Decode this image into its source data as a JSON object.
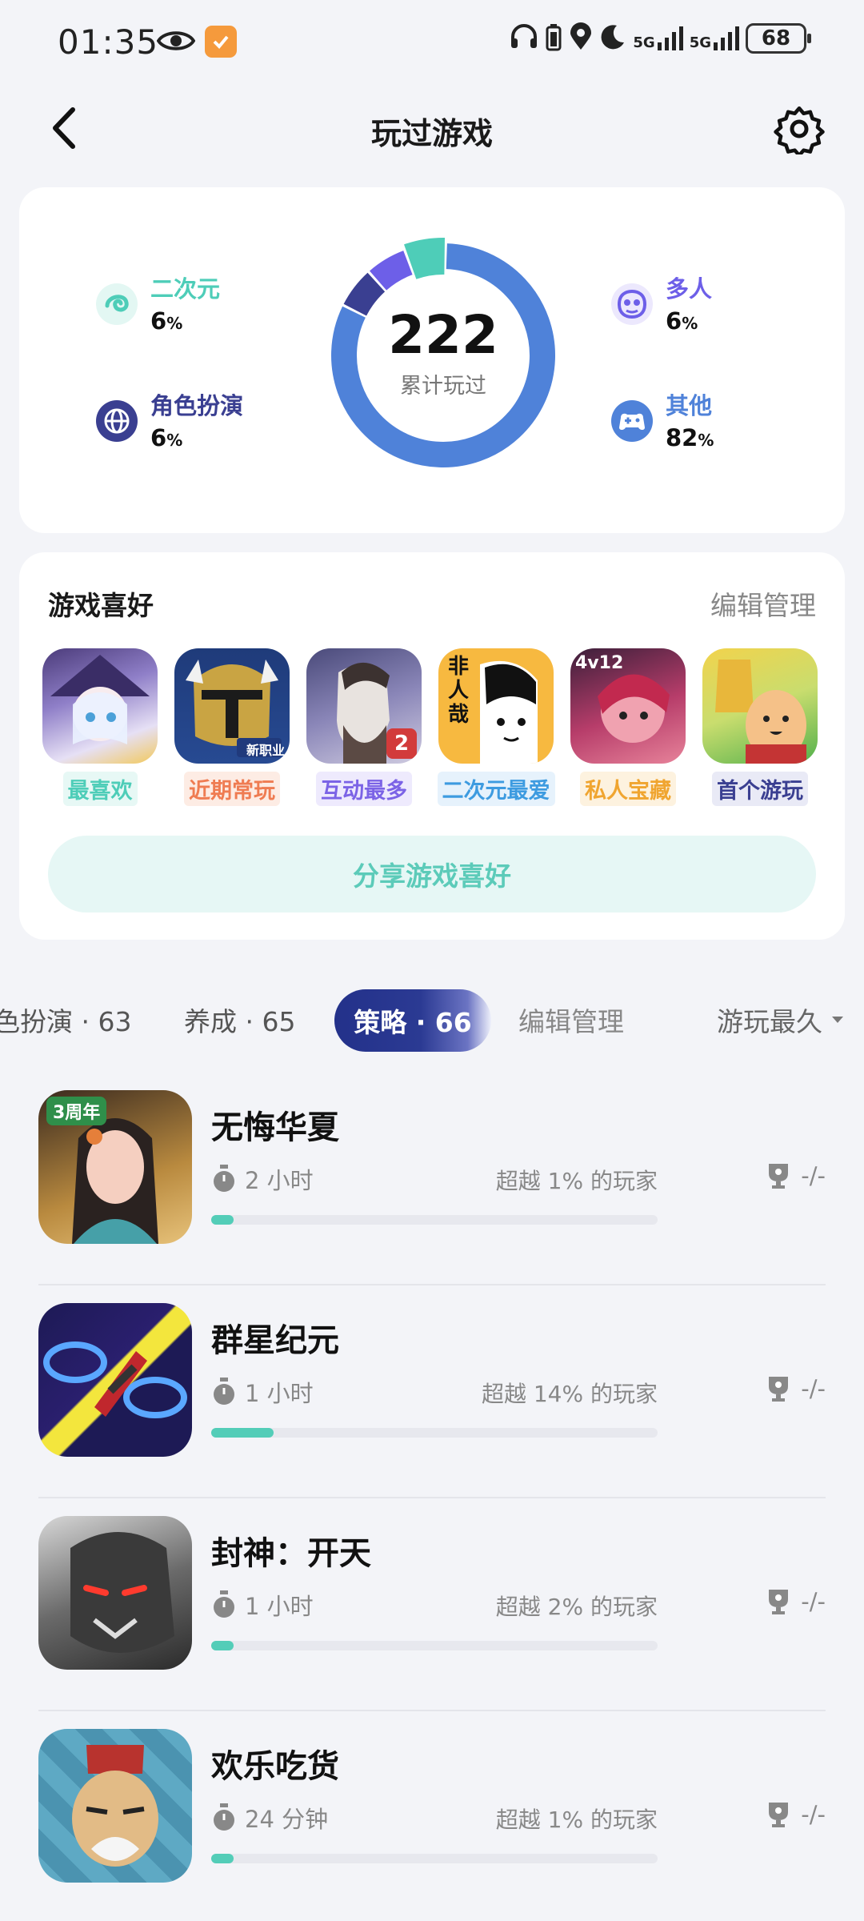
{
  "status_bar": {
    "time": "01:35",
    "signal1": "5G",
    "signal2": "5G",
    "battery": "68"
  },
  "header": {
    "title": "玩过游戏"
  },
  "stats": {
    "total": "222",
    "total_label": "累计玩过",
    "categories": [
      {
        "label": "二次元",
        "value": "6",
        "unit": "%",
        "color": "#4ecdb8",
        "icon": "anime-swirl-icon",
        "percent": 6
      },
      {
        "label": "角色扮演",
        "value": "6",
        "unit": "%",
        "color": "#3a3f91",
        "icon": "globe-icon",
        "percent": 6
      },
      {
        "label": "多人",
        "value": "6",
        "unit": "%",
        "color": "#6d5fe8",
        "icon": "multiplayer-icon",
        "percent": 6
      },
      {
        "label": "其他",
        "value": "82",
        "unit": "%",
        "color": "#4f82d9",
        "icon": "gamepad-icon",
        "percent": 82
      }
    ]
  },
  "preferences": {
    "title": "游戏喜好",
    "edit_label": "编辑管理",
    "share_label": "分享游戏喜好",
    "items": [
      {
        "tag": "最喜欢",
        "tag_color": "#4ecdb8",
        "tag_bg": "#e7f8f5",
        "badge": ""
      },
      {
        "tag": "近期常玩",
        "tag_color": "#ef7c52",
        "tag_bg": "#fdece4",
        "badge": "新职业"
      },
      {
        "tag": "互动最多",
        "tag_color": "#7b63e6",
        "tag_bg": "#eeeafd",
        "badge": "2"
      },
      {
        "tag": "二次元最爱",
        "tag_color": "#3d9be0",
        "tag_bg": "#e6f2fc",
        "badge": "非人哉"
      },
      {
        "tag": "私人宝藏",
        "tag_color": "#f0a530",
        "tag_bg": "#fdf2df",
        "badge": "4v12"
      },
      {
        "tag": "首个游玩",
        "tag_color": "#3a3f91",
        "tag_bg": "#e9eaf6",
        "badge": ""
      }
    ]
  },
  "tabs": {
    "items": [
      "色扮演 · 63",
      "养成 · 65"
    ],
    "active": "策略 · 66",
    "edit_label": "编辑管理",
    "sort_label": "游玩最久"
  },
  "games": [
    {
      "name": "无悔华夏",
      "time": "2 小时",
      "rank": "超越 1% 的玩家",
      "achievement": "-/-",
      "progress": 0.01,
      "badge": "3周年"
    },
    {
      "name": "群星纪元",
      "time": "1 小时",
      "rank": "超越 14% 的玩家",
      "achievement": "-/-",
      "progress": 0.14,
      "badge": ""
    },
    {
      "name": "封神：开天",
      "time": "1 小时",
      "rank": "超越 2% 的玩家",
      "achievement": "-/-",
      "progress": 0.02,
      "badge": ""
    },
    {
      "name": "欢乐吃货",
      "time": "24 分钟",
      "rank": "超越 1% 的玩家",
      "achievement": "-/-",
      "progress": 0.01,
      "badge": ""
    }
  ]
}
